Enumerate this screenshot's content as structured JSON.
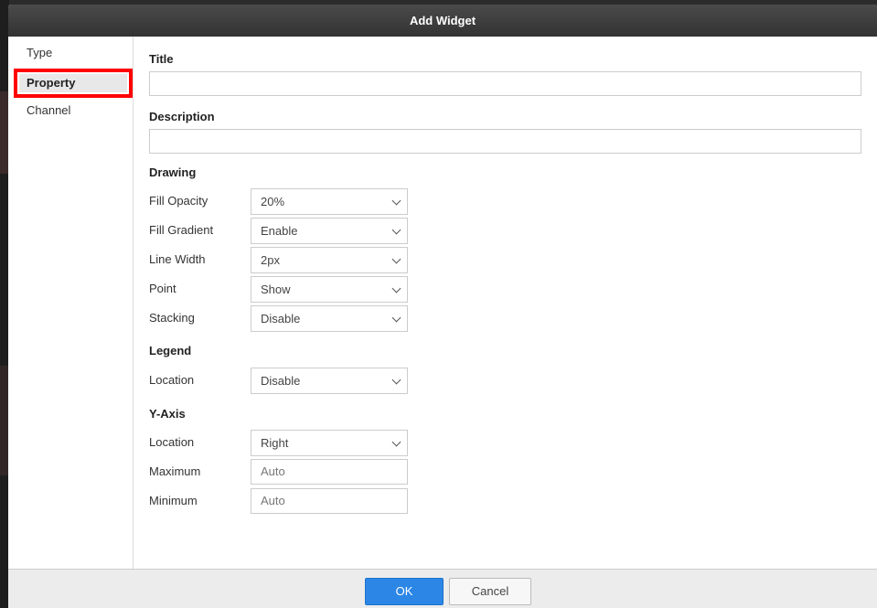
{
  "dialog": {
    "title": "Add Widget"
  },
  "sidebar": {
    "items": [
      {
        "label": "Type"
      },
      {
        "label": "Property"
      },
      {
        "label": "Channel"
      }
    ]
  },
  "form": {
    "title_label": "Title",
    "title_value": "",
    "description_label": "Description",
    "description_value": "",
    "drawing": {
      "heading": "Drawing",
      "fill_opacity": {
        "label": "Fill Opacity",
        "value": "20%"
      },
      "fill_gradient": {
        "label": "Fill Gradient",
        "value": "Enable"
      },
      "line_width": {
        "label": "Line Width",
        "value": "2px"
      },
      "point": {
        "label": "Point",
        "value": "Show"
      },
      "stacking": {
        "label": "Stacking",
        "value": "Disable"
      }
    },
    "legend": {
      "heading": "Legend",
      "location": {
        "label": "Location",
        "value": "Disable"
      }
    },
    "y_axis": {
      "heading": "Y-Axis",
      "location": {
        "label": "Location",
        "value": "Right"
      },
      "maximum": {
        "label": "Maximum",
        "placeholder": "Auto"
      },
      "minimum": {
        "label": "Minimum",
        "placeholder": "Auto"
      }
    }
  },
  "footer": {
    "ok_label": "OK",
    "cancel_label": "Cancel"
  },
  "colors": {
    "accent": "#2b86e6",
    "highlight": "#ff0000",
    "titlebar": "#3a3a3a"
  }
}
